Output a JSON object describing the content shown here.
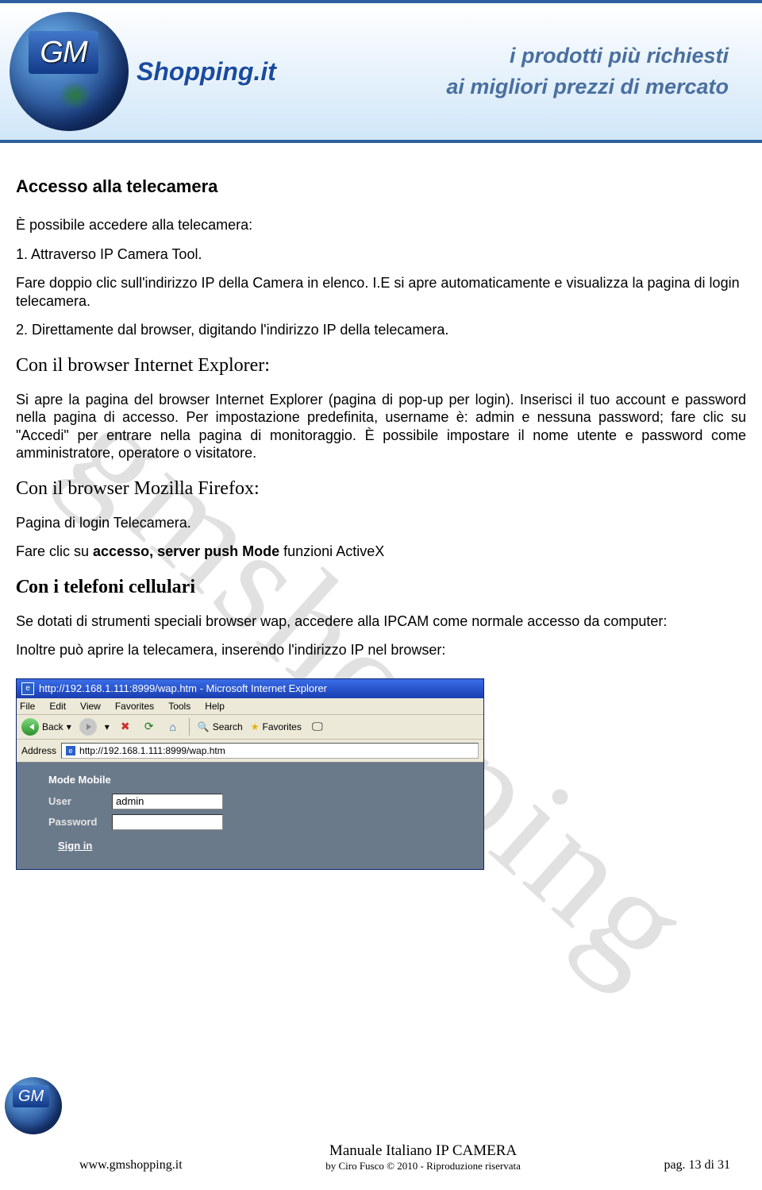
{
  "banner": {
    "logo_badge": "GM",
    "logo_text": "Shopping.it",
    "tagline1": "i prodotti più richiesti",
    "tagline2": "ai migliori prezzi di mercato"
  },
  "watermark": "gmshopping",
  "doc": {
    "title": "Accesso alla telecamera",
    "intro": "È possibile accedere alla telecamera:",
    "step1": "1. Attraverso IP Camera Tool.",
    "step1_desc": " Fare doppio clic sull'indirizzo IP della Camera in elenco. I.E si apre automaticamente e visualizza la pagina di login telecamera.",
    "step2": "2.  Direttamente dal browser, digitando l'indirizzo IP della telecamera.",
    "h_ie": "Con il browser Internet Explorer:",
    "p_ie": "Si apre la pagina del  browser Internet Explorer  (pagina di pop-up per login). Inserisci il tuo account e password nella pagina di accesso. Per impostazione predefinita, username è: admin e nessuna password; fare clic su \"Accedi\" per entrare nella pagina di monitoraggio. È possibile impostare il nome utente e password come amministratore, operatore o visitatore.",
    "h_ff": "Con il browser Mozilla Firefox:",
    "p_ff": "Pagina di login Telecamera.",
    "p_ff2_pre": " Fare clic su ",
    "p_ff2_bold": "accesso, server push Mode",
    "p_ff2_post": " funzioni ActiveX",
    "h_cell_pre": "C",
    "h_cell_rest": "on i telefoni cellulari",
    "p_cell": "Se dotati di strumenti speciali browser wap, accedere alla IPCAM  come normale accesso da computer:",
    "p_cell2": " Inoltre può aprire la telecamera, inserendo l'indirizzo IP nel browser:"
  },
  "ie": {
    "title_url": "http://192.168.1.111:8999/wap.htm - Microsoft Internet Explorer",
    "menu": [
      "File",
      "Edit",
      "View",
      "Favorites",
      "Tools",
      "Help"
    ],
    "back": "Back",
    "search": "Search",
    "favorites": "Favorites",
    "addr_label": "Address",
    "addr_value": "http://192.168.1.111:8999/wap.htm",
    "mode": "Mode Mobile",
    "user_label": "User",
    "user_value": "admin",
    "pass_label": "Password",
    "pass_value": "",
    "signin": "Sign in"
  },
  "footer": {
    "site": "www.gmshopping.it",
    "manual": "Manuale Italiano IP CAMERA",
    "copyright": "by Ciro Fusco © 2010 - Riproduzione riservata",
    "page": "pag.  13  di 31"
  }
}
